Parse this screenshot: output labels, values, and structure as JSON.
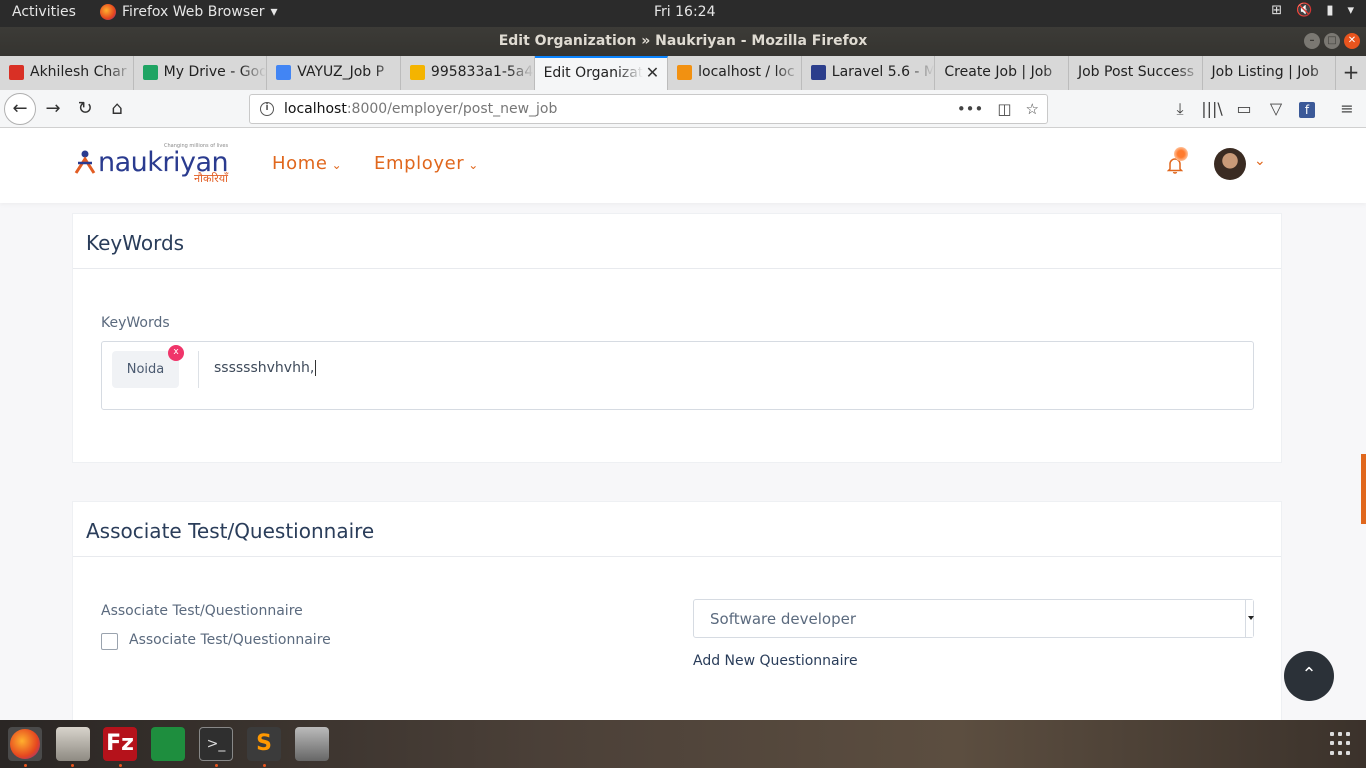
{
  "system": {
    "activities": "Activities",
    "app_menu": "Firefox Web Browser",
    "clock": "Fri 16:24"
  },
  "window": {
    "title": "Edit Organization » Naukriyan - Mozilla Firefox"
  },
  "tabs": [
    {
      "label": "Akhilesh Char",
      "icon_color": "#d93025"
    },
    {
      "label": "My Drive - Goo",
      "icon_color": "#1fa463"
    },
    {
      "label": "VAYUZ_Job P",
      "icon_color": "#4285f4"
    },
    {
      "label": "995833a1-5a4",
      "icon_color": "#f4b400"
    },
    {
      "label": "Edit Organizat",
      "icon_color": "#ffffff",
      "active": true
    },
    {
      "label": "localhost / loc",
      "icon_color": "#f29111"
    },
    {
      "label": "Laravel 5.6 - M",
      "icon_color": "#2c3e8c"
    },
    {
      "label": "Create Job | Job",
      "icon_color": ""
    },
    {
      "label": "Job Post Success",
      "icon_color": ""
    },
    {
      "label": "Job Listing | Job",
      "icon_color": ""
    }
  ],
  "urlbar": {
    "host": "localhost",
    "rest": ":8000/employer/post_new_job"
  },
  "site": {
    "brand": "naukriyan",
    "tagline": "Changing millions of lives",
    "brand_hindi": "नौकरियाँ",
    "nav": {
      "home": "Home",
      "employer": "Employer"
    }
  },
  "keywords_card": {
    "title": "KeyWords",
    "field_label": "KeyWords",
    "tags": [
      "Noida"
    ],
    "tag_remove": "x",
    "input_value": "sssssshvhvhh,"
  },
  "questionnaire_card": {
    "title": "Associate Test/Questionnaire",
    "field_label": "Associate Test/Questionnaire",
    "checkbox_label": "Associate Test/Questionnaire",
    "checkbox_checked": false,
    "select_value": "Software developer",
    "add_link": "Add New Questionnaire"
  },
  "colors": {
    "accent": "#e0671d",
    "brand_blue": "#2a3b8f",
    "tag_remove": "#f0356a"
  }
}
